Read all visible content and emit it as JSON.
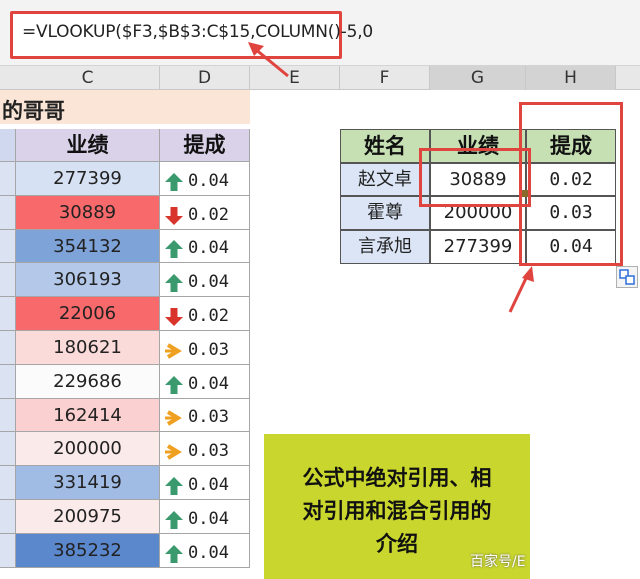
{
  "formula_bar": {
    "formula": "=VLOOKUP($F3,$B$3:C$15,COLUMN()-5,0"
  },
  "columns": [
    "C",
    "D",
    "E",
    "F",
    "G",
    "H"
  ],
  "title_partial": "的哥哥",
  "left_table": {
    "headers": [
      "业绩",
      "提成"
    ],
    "rows": [
      {
        "value": "277399",
        "fill": "#d6e1f3",
        "icon": "green-up",
        "rate": "0.04"
      },
      {
        "value": "30889",
        "fill": "#f8696b",
        "icon": "red-down",
        "rate": "0.02"
      },
      {
        "value": "354132",
        "fill": "#7ea3d8",
        "icon": "green-up",
        "rate": "0.04"
      },
      {
        "value": "306193",
        "fill": "#b4c9ea",
        "icon": "green-up",
        "rate": "0.04"
      },
      {
        "value": "22006",
        "fill": "#f8696b",
        "icon": "red-down",
        "rate": "0.02"
      },
      {
        "value": "180621",
        "fill": "#fbdada",
        "icon": "yellow-right",
        "rate": "0.03"
      },
      {
        "value": "229686",
        "fill": "#fbfbfb",
        "icon": "green-up",
        "rate": "0.04"
      },
      {
        "value": "162414",
        "fill": "#fbd0d0",
        "icon": "yellow-right",
        "rate": "0.03"
      },
      {
        "value": "200000",
        "fill": "#fbeaea",
        "icon": "yellow-right",
        "rate": "0.03"
      },
      {
        "value": "331419",
        "fill": "#a0bbe4",
        "icon": "green-up",
        "rate": "0.04"
      },
      {
        "value": "200975",
        "fill": "#fbeaea",
        "icon": "green-up",
        "rate": "0.04"
      },
      {
        "value": "385232",
        "fill": "#5b87cc",
        "icon": "green-up",
        "rate": "0.04"
      }
    ]
  },
  "right_table": {
    "headers": [
      "姓名",
      "业绩",
      "提成"
    ],
    "rows": [
      {
        "name": "赵文卓",
        "value": "30889",
        "rate": "0.02"
      },
      {
        "name": "霍尊",
        "value": "200000",
        "rate": "0.03"
      },
      {
        "name": "言承旭",
        "value": "277399",
        "rate": "0.04"
      }
    ]
  },
  "callout": {
    "lines": [
      "公式中绝对引用、相",
      "对引用和混合引用的",
      "介绍"
    ]
  },
  "watermark": "百家号/E"
}
